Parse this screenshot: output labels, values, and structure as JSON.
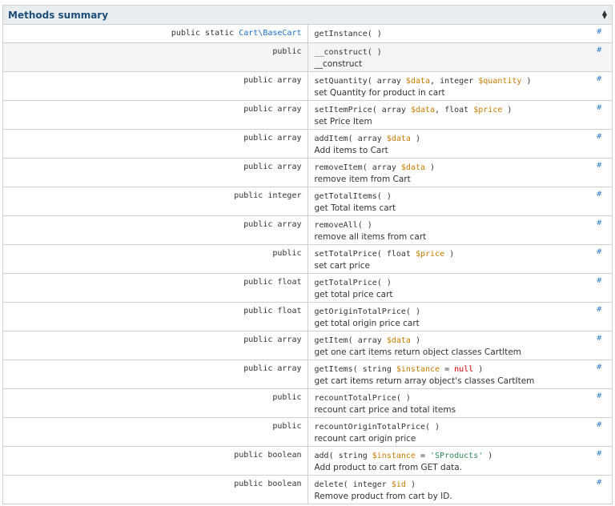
{
  "header": {
    "title": "Methods summary"
  },
  "anchor_symbol": "#",
  "methods": [
    {
      "modifiers": "public static",
      "return_link": "Cart\\BaseCart",
      "name": "getInstance",
      "params": [],
      "description": ""
    },
    {
      "modifiers": "public",
      "return_link": "",
      "name": "__construct",
      "params": [],
      "description": "__construct"
    },
    {
      "modifiers": "public array",
      "return_link": "",
      "name": "setQuantity",
      "params": [
        {
          "type": "array",
          "var": "$data"
        },
        {
          "type": "integer",
          "var": "$quantity"
        }
      ],
      "description": "set Quantity for product in cart"
    },
    {
      "modifiers": "public array",
      "return_link": "",
      "name": "setItemPrice",
      "params": [
        {
          "type": "array",
          "var": "$data"
        },
        {
          "type": "float",
          "var": "$price"
        }
      ],
      "description": "set Price Item"
    },
    {
      "modifiers": "public array",
      "return_link": "",
      "name": "addItem",
      "params": [
        {
          "type": "array",
          "var": "$data"
        }
      ],
      "description": "Add items to Cart"
    },
    {
      "modifiers": "public array",
      "return_link": "",
      "name": "removeItem",
      "params": [
        {
          "type": "array",
          "var": "$data"
        }
      ],
      "description": "remove item from Cart"
    },
    {
      "modifiers": "public integer",
      "return_link": "",
      "name": "getTotalItems",
      "params": [],
      "description": "get Total items cart"
    },
    {
      "modifiers": "public array",
      "return_link": "",
      "name": "removeAll",
      "params": [],
      "description": "remove all items from cart"
    },
    {
      "modifiers": "public",
      "return_link": "",
      "name": "setTotalPrice",
      "params": [
        {
          "type": "float",
          "var": "$price"
        }
      ],
      "description": "set cart price"
    },
    {
      "modifiers": "public float",
      "return_link": "",
      "name": "getTotalPrice",
      "params": [],
      "description": "get total price cart"
    },
    {
      "modifiers": "public float",
      "return_link": "",
      "name": "getOriginTotalPrice",
      "params": [],
      "description": "get total origin price cart"
    },
    {
      "modifiers": "public array",
      "return_link": "",
      "name": "getItem",
      "params": [
        {
          "type": "array",
          "var": "$data"
        }
      ],
      "description": "get one cart items return object classes CartItem"
    },
    {
      "modifiers": "public array",
      "return_link": "",
      "name": "getItems",
      "params": [
        {
          "type": "string",
          "var": "$instance",
          "default": "null",
          "default_kind": "kw"
        }
      ],
      "description": "get cart items return array object's classes CartItem"
    },
    {
      "modifiers": "public",
      "return_link": "",
      "name": "recountTotalPrice",
      "params": [],
      "description": "recount cart price and total items"
    },
    {
      "modifiers": "public",
      "return_link": "",
      "name": "recountOriginTotalPrice",
      "params": [],
      "description": "recount cart origin price"
    },
    {
      "modifiers": "public boolean",
      "return_link": "",
      "name": "add",
      "params": [
        {
          "type": "string",
          "var": "$instance",
          "default": "'SProducts'",
          "default_kind": "str"
        }
      ],
      "description": "Add product to cart from GET data."
    },
    {
      "modifiers": "public boolean",
      "return_link": "",
      "name": "delete",
      "params": [
        {
          "type": "integer",
          "var": "$id"
        }
      ],
      "description": "Remove product from cart by ID."
    }
  ]
}
